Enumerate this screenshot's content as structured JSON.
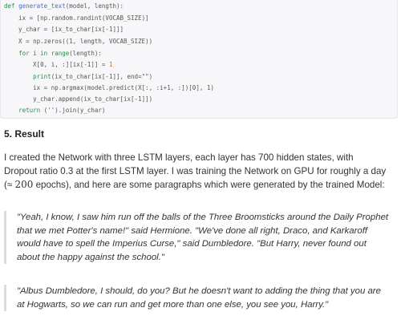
{
  "code": {
    "lines": [
      [
        {
          "t": "def ",
          "c": "kw"
        },
        {
          "t": "generate_text",
          "c": "fn"
        },
        {
          "t": "(model, length):"
        }
      ],
      [
        {
          "t": "    ix = [np.random.randint(VOCAB_SIZE)]"
        }
      ],
      [
        {
          "t": "    y_char = [ix_to_char[ix[-1]]]"
        }
      ],
      [
        {
          "t": "    X = np.zeros((1, length, VOCAB_SIZE))"
        }
      ],
      [
        {
          "t": "    "
        },
        {
          "t": "for",
          "c": "kw"
        },
        {
          "t": " i "
        },
        {
          "t": "in",
          "c": "kw"
        },
        {
          "t": " "
        },
        {
          "t": "range",
          "c": "kw"
        },
        {
          "t": "(length):"
        }
      ],
      [
        {
          "t": "        X[0, i, :][ix[-1]] = "
        },
        {
          "t": "1",
          "c": "num"
        }
      ],
      [
        {
          "t": "        "
        },
        {
          "t": "print",
          "c": "kw"
        },
        {
          "t": "(ix_to_char[ix[-1]], end=\"\")"
        }
      ],
      [
        {
          "t": "        ix = np.argmax(model.predict(X[:, :i+1, :])[0], 1)"
        }
      ],
      [
        {
          "t": "        y_char.append(ix_to_char[ix[-1]])"
        }
      ],
      [
        {
          "t": "    "
        },
        {
          "t": "return",
          "c": "kw"
        },
        {
          "t": " ('').join(y_char)"
        }
      ]
    ]
  },
  "section": {
    "heading": "5. Result",
    "para_before": "I created the Network with three LSTM layers, each layer has 700 hidden states, with Dropout ratio 0.3 at the first LSTM layer. I was training the Network on GPU for roughly a day (≈ ",
    "para_number": "200",
    "para_after": " epochs), and here are some paragraphs which were generated by the trained Model:"
  },
  "quotes": [
    "\"Yeah, I know, I saw him run off the balls of the Three Broomsticks around the Daily Prophet that we met Potter's name!\" said Hermione. \"We've done all right, Draco, and Karkaroff would have to spell the Imperius Curse,\" said Dumbledore. \"But Harry, never found out about the happy against the school.\"",
    "\"Albus Dumbledore, I should, do you? But he doesn't want to adding the thing that you are at Hogwarts, so we can run and get more than one else, you see you, Harry.\""
  ]
}
